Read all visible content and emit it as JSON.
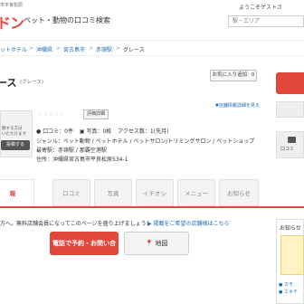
{
  "header": {
    "logo_subtext": "市平良松原",
    "logo": "ドン",
    "site_title": "ペット・動物の口コミ検索",
    "welcome": "ようこそゲストさ",
    "search_placeholder": "駅・エリア"
  },
  "breadcrumb": {
    "items": [
      "ットホテル",
      "沖縄県",
      "宮古島市",
      "赤嶺駅"
    ],
    "current": "グレース"
  },
  "shop": {
    "name": "ース",
    "ruby": "(グレース)",
    "fav_label": "お気に入り追加",
    "fav_count": "0",
    "edit_link": "▼店舗情報詳細を見る",
    "rating_label": "評価詳細",
    "stars": "☆☆☆☆☆",
    "reviews": "● 口コミ：0件",
    "photos": "写真：0枚",
    "access": "アクセス数：1(先月)",
    "genre": "ジャンル：ペット動物 / ペットホテル / ペットサロン/トリミングサロン / ペットショップ",
    "station": "最寄駅：赤嶺駅 / 那覇空港駅",
    "address": "住所：沖縄県宮古島市平良松原534-1"
  },
  "left_panel": {
    "text1": "稿する方は",
    "text2": "いただけます",
    "post_label": "投稿する"
  },
  "right_panel": {
    "comment_label": "口コミ"
  },
  "tabs": [
    {
      "label": "報",
      "active": true
    },
    {
      "label": "口コミ",
      "active": false
    },
    {
      "label": "写真",
      "active": false
    },
    {
      "label": "イチオシ",
      "active": false
    },
    {
      "label": "メニュー",
      "active": false
    },
    {
      "label": "お知らせ",
      "active": false
    }
  ],
  "notice": {
    "text": "方へ。無料店舗会員になってこのページを盛り上げましょう！",
    "link": "▶ 掲載をご希望の店舗様はこちら"
  },
  "actions": {
    "tel_label": "電話で予約・お問い合わせ",
    "map_label": "地図"
  },
  "side": {
    "title": "お知らせ",
    "links": [
      "● カモ",
      "● エキテ"
    ]
  }
}
